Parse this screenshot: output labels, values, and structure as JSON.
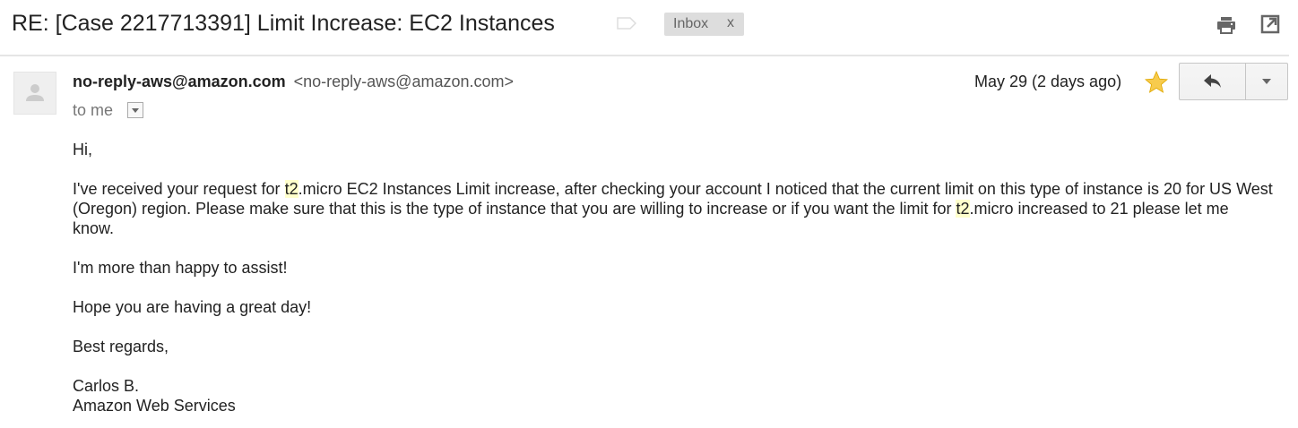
{
  "header": {
    "subject": "RE: [Case 2217713391] Limit Increase: EC2 Instances",
    "label_chip": {
      "label": "Inbox",
      "remove": "x"
    },
    "icons": {
      "label": "label-tag-icon",
      "print": "print-icon",
      "open_new_window": "open-in-new-window-icon"
    }
  },
  "message": {
    "sender_name": "no-reply-aws@amazon.com",
    "sender_email": "<no-reply-aws@amazon.com>",
    "recipient": "to me",
    "date": "May 29 (2 days ago)",
    "starred": true,
    "star_color": "#f7cb4d",
    "highlight_color": "#ffffcc",
    "icons": {
      "avatar": "default-avatar-icon",
      "star": "star-icon",
      "reply": "reply-arrow-icon",
      "more": "chevron-down-icon"
    }
  },
  "body": {
    "greeting": "Hi,",
    "para1": {
      "s1": "I've received your request for ",
      "hl1": "t2",
      "s2": ".micro EC2 Instances Limit increase, after checking your account I noticed that the current limit on this type of instance is 20 for US West (Oregon) region. Please make sure that this is the type of instance that you are willing to increase or if you want the limit for ",
      "hl2": "t2",
      "s3": ".micro increased to 21 please let me know."
    },
    "para2": "I'm more than happy to assist!",
    "para3": "Hope you are having a great day!",
    "closing": "Best regards,",
    "signature_name": "Carlos B.",
    "signature_company": "Amazon Web Services"
  }
}
